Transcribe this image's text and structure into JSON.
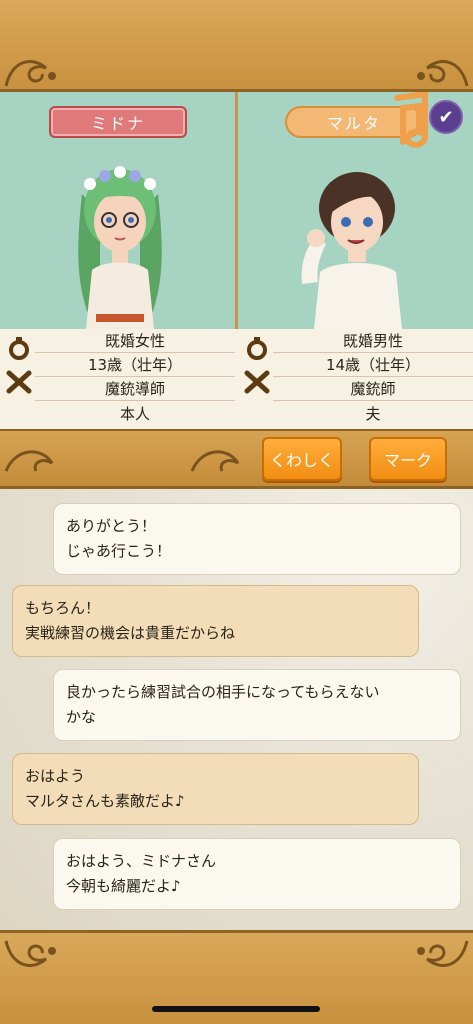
{
  "profiles": {
    "left": {
      "name": "ミドナ",
      "rows": [
        "既婚女性",
        "13歳（壮年）",
        "魔銃導師",
        "本人"
      ]
    },
    "right": {
      "name": "マルタ",
      "rows": [
        "既婚男性",
        "14歳（壮年）",
        "魔銃師",
        "夫"
      ]
    }
  },
  "actions": {
    "detail_label": "くわしく",
    "mark_label": "マーク"
  },
  "chat": {
    "messages": [
      {
        "side": "right",
        "lines": [
          "ありがとう！",
          "じゃあ行こう！"
        ]
      },
      {
        "side": "left",
        "lines": [
          "もちろん！",
          "実戦練習の機会は貴重だからね"
        ]
      },
      {
        "side": "right",
        "lines": [
          "良かったら練習試合の相手になってもらえない",
          "かな"
        ]
      },
      {
        "side": "left",
        "lines": [
          "おはよう",
          "マルタさんも素敵だよ♪"
        ]
      },
      {
        "side": "right",
        "lines": [
          "おはよう、ミドナさん",
          "今朝も綺麗だよ♪"
        ]
      }
    ]
  },
  "icons": {
    "ring": "ring-icon",
    "swords": "crossed-guns-icon",
    "badge": "check-badge-icon",
    "note": "music-note-icon"
  },
  "colors": {
    "frame_gold": "#c8913f",
    "profile_bg": "#a7d3c2",
    "button_orange": "#f28d13",
    "left_bubble": "#f3dcb8",
    "right_bubble": "#fbf8f0"
  }
}
